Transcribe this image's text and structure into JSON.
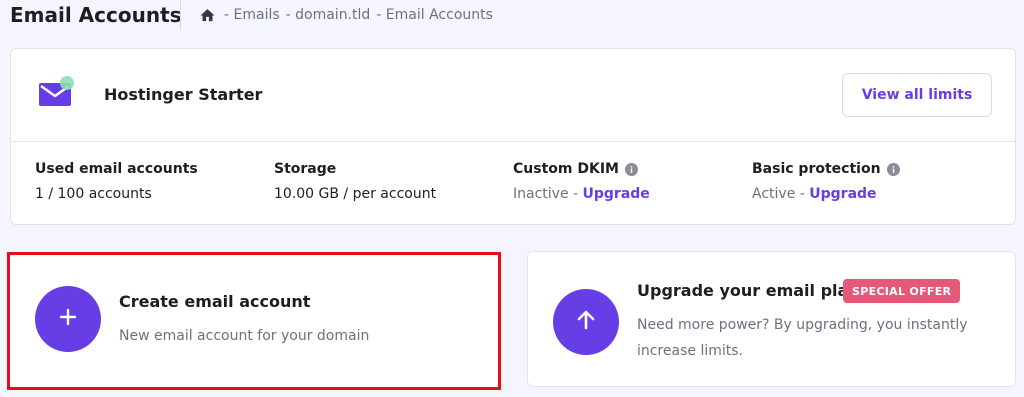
{
  "header": {
    "title": "Email Accounts",
    "breadcrumb": [
      "- Emails",
      "- domain.tld",
      "- Email Accounts"
    ]
  },
  "plan": {
    "name": "Hostinger Starter",
    "view_limits_label": "View all limits",
    "stats": [
      {
        "label": "Used email accounts",
        "value": "1 / 100 accounts"
      },
      {
        "label": "Storage",
        "value": "10.00 GB / per account"
      },
      {
        "label": "Custom DKIM",
        "status": "Inactive - ",
        "link": "Upgrade"
      },
      {
        "label": "Basic protection",
        "status": "Active - ",
        "link": "Upgrade"
      }
    ]
  },
  "create_card": {
    "title": "Create email account",
    "description": "New email account for your domain"
  },
  "upgrade_card": {
    "title": "Upgrade your email plan",
    "badge": "SPECIAL OFFER",
    "description": "Need more power? By upgrading, you instantly increase limits."
  },
  "colors": {
    "accent": "#673de6",
    "badge": "#e45978",
    "highlight": "#e3101a",
    "background": "#f4f5ff"
  },
  "icons": {
    "home": "home-icon",
    "plan": "email-envelope-icon",
    "info": "info-icon",
    "plus": "plus-icon",
    "arrow": "arrow-up-icon"
  }
}
